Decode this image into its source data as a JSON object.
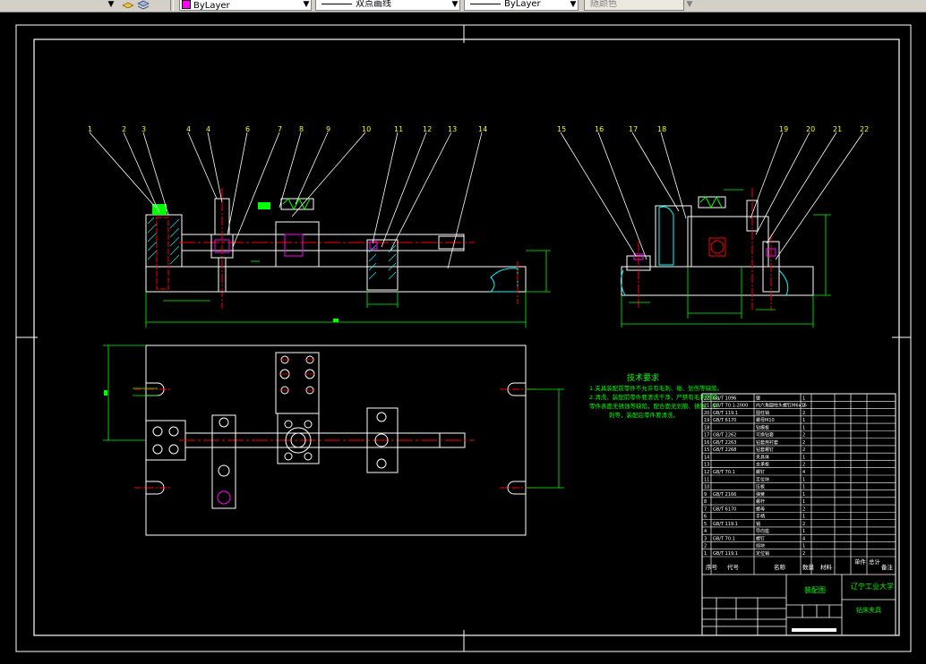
{
  "toolbar": {
    "layer_icons": [
      "layer-state-icon",
      "layer-manager-icon"
    ],
    "color_control": {
      "value": "ByLayer",
      "swatch": "#ff00ff"
    },
    "linetype_control": {
      "value": "双点画线"
    },
    "lineweight_control": {
      "value": "ByLayer"
    },
    "plotstyle_control": {
      "value": "随颜色"
    }
  },
  "drawing": {
    "background": "#000000",
    "front_view_labels": [
      "1",
      "2",
      "3",
      "4",
      "4",
      "6",
      "7",
      "8",
      "9",
      "10",
      "11",
      "12",
      "13",
      "14"
    ],
    "side_view_labels": [
      "15",
      "16",
      "17",
      "18",
      "19",
      "20",
      "21",
      "22"
    ],
    "tech_requirements": {
      "title": "技术要求",
      "lines": [
        "1.夹具装配前零件不允许有毛刺、碰、划伤等缺陷。",
        "2.清洗、装配前零件要清洗干净，严禁有毛刺残留，",
        "零件表面无锈蚀等缺陷，配合面无划痕、锈蚀、毛",
        "刺等，装配后零件要清洗。"
      ]
    },
    "title_block": {
      "drawing_title": "装配图",
      "school": "辽宁工业大学",
      "part_name": "钻床夹具",
      "headers": [
        "序号",
        "代号",
        "名称",
        "数量",
        "材料",
        "单件",
        "总计",
        "备注"
      ],
      "rows": [
        [
          "22",
          "GB/T 1096",
          "键",
          "1"
        ],
        [
          "21",
          "GB/T 70.1-2000",
          "内六角圆柱头螺钉M6x16",
          "2"
        ],
        [
          "20",
          "GB/T 119.1",
          "圆柱销",
          "2"
        ],
        [
          "19",
          "GB/T 6170",
          "螺母M10",
          "1"
        ],
        [
          "18",
          "",
          "钻模板",
          "1"
        ],
        [
          "17",
          "GB/T 2262",
          "可换钻套",
          "2"
        ],
        [
          "16",
          "GB/T 2263",
          "钻套用衬套",
          "2"
        ],
        [
          "15",
          "GB/T 2268",
          "钻套螺钉",
          "2"
        ],
        [
          "14",
          "",
          "夹具体",
          "1"
        ],
        [
          "13",
          "",
          "支承板",
          "2"
        ],
        [
          "12",
          "GB/T 70.1",
          "螺钉",
          "4"
        ],
        [
          "11",
          "",
          "定位块",
          "1"
        ],
        [
          "10",
          "",
          "压板",
          "1"
        ],
        [
          "9",
          "GB/T 2166",
          "弹簧",
          "1"
        ],
        [
          "8",
          "",
          "螺杆",
          "1"
        ],
        [
          "7",
          "GB/T 6170",
          "螺母",
          "2"
        ],
        [
          "6",
          "",
          "手柄",
          "1"
        ],
        [
          "5",
          "GB/T 119.1",
          "销",
          "2"
        ],
        [
          "4",
          "",
          "导向座",
          "1"
        ],
        [
          "3",
          "GB/T 70.1",
          "螺钉",
          "4"
        ],
        [
          "2",
          "",
          "挡块",
          "1"
        ],
        [
          "1",
          "GB/T 119.1",
          "定位销",
          "2"
        ]
      ]
    },
    "colors": {
      "outline": "#ffffff",
      "dimension": "#00ff00",
      "centerline": "#ff0000",
      "section_fill": "#00ffff",
      "leader": "#ffffff",
      "highlight": "#ff00ff",
      "annotation": "#00ff00",
      "label": "#ffff00"
    }
  }
}
